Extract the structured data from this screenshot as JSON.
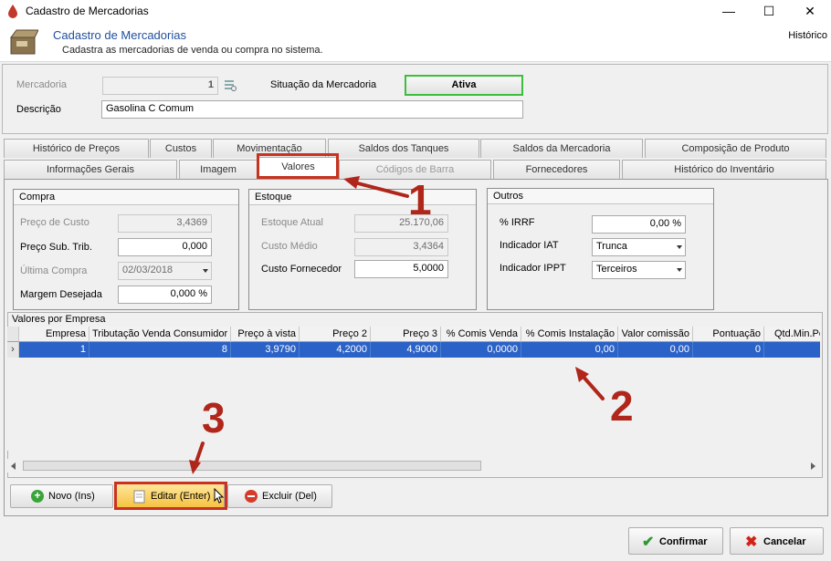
{
  "window": {
    "title": "Cadastro de Mercadorias",
    "minimize": "—",
    "maximize": "☐",
    "close": "✕"
  },
  "header": {
    "title": "Cadastro de Mercadorias",
    "subtitle": "Cadastra as mercadorias de venda ou compra no sistema.",
    "history_link": "Histórico"
  },
  "form": {
    "mercadoria_label": "Mercadoria",
    "mercadoria_value": "1",
    "situacao_label": "Situação da Mercadoria",
    "situacao_value": "Ativa",
    "descricao_label": "Descrição",
    "descricao_value": "Gasolina C Comum"
  },
  "tabs_row1": [
    "Histórico de Preços",
    "Custos",
    "Movimentação",
    "Saldos dos Tanques",
    "Saldos da Mercadoria",
    "Composição de Produto"
  ],
  "tabs_row2": [
    "Informações Gerais",
    "Imagem",
    "Valores",
    "Códigos de Barra",
    "Fornecedores",
    "Histórico do Inventário"
  ],
  "compra": {
    "title": "Compra",
    "preco_custo_label": "Preço de Custo",
    "preco_custo_value": "3,4369",
    "preco_sub_label": "Preço Sub. Trib.",
    "preco_sub_value": "0,000",
    "ultima_compra_label": "Última Compra",
    "ultima_compra_value": "02/03/2018",
    "margem_label": "Margem Desejada",
    "margem_value": "0,000 %"
  },
  "estoque": {
    "title": "Estoque",
    "atual_label": "Estoque Atual",
    "atual_value": "25.170,06",
    "medio_label": "Custo Médio",
    "medio_value": "3,4364",
    "fornecedor_label": "Custo Fornecedor",
    "fornecedor_value": "5,0000"
  },
  "outros": {
    "title": "Outros",
    "irrf_label": "% IRRF",
    "irrf_value": "0,00 %",
    "iat_label": "Indicador IAT",
    "iat_value": "Trunca",
    "ippt_label": "Indicador IPPT",
    "ippt_value": "Terceiros"
  },
  "grid": {
    "title": "Valores por Empresa",
    "columns": [
      "Empresa",
      "Tributação Venda Consumidor",
      "Preço à vista",
      "Preço 2",
      "Preço 3",
      "% Comis Venda",
      "% Comis Instalação",
      "Valor comissão",
      "Pontuação",
      "Qtd.Min.Po"
    ],
    "row": [
      "1",
      "8",
      "3,9790",
      "4,2000",
      "4,9000",
      "0,0000",
      "0,00",
      "0,00",
      "0",
      ""
    ]
  },
  "buttons": {
    "novo": "Novo (Ins)",
    "editar": "Editar (Enter)",
    "excluir": "Excluir (Del)",
    "confirmar": "Confirmar",
    "cancelar": "Cancelar"
  },
  "annotations": {
    "one": "1",
    "two": "2",
    "three": "3"
  },
  "colors": {
    "accent_red": "#b0261a",
    "selection_blue": "#2b62c8",
    "active_green": "#3cbf3c"
  }
}
